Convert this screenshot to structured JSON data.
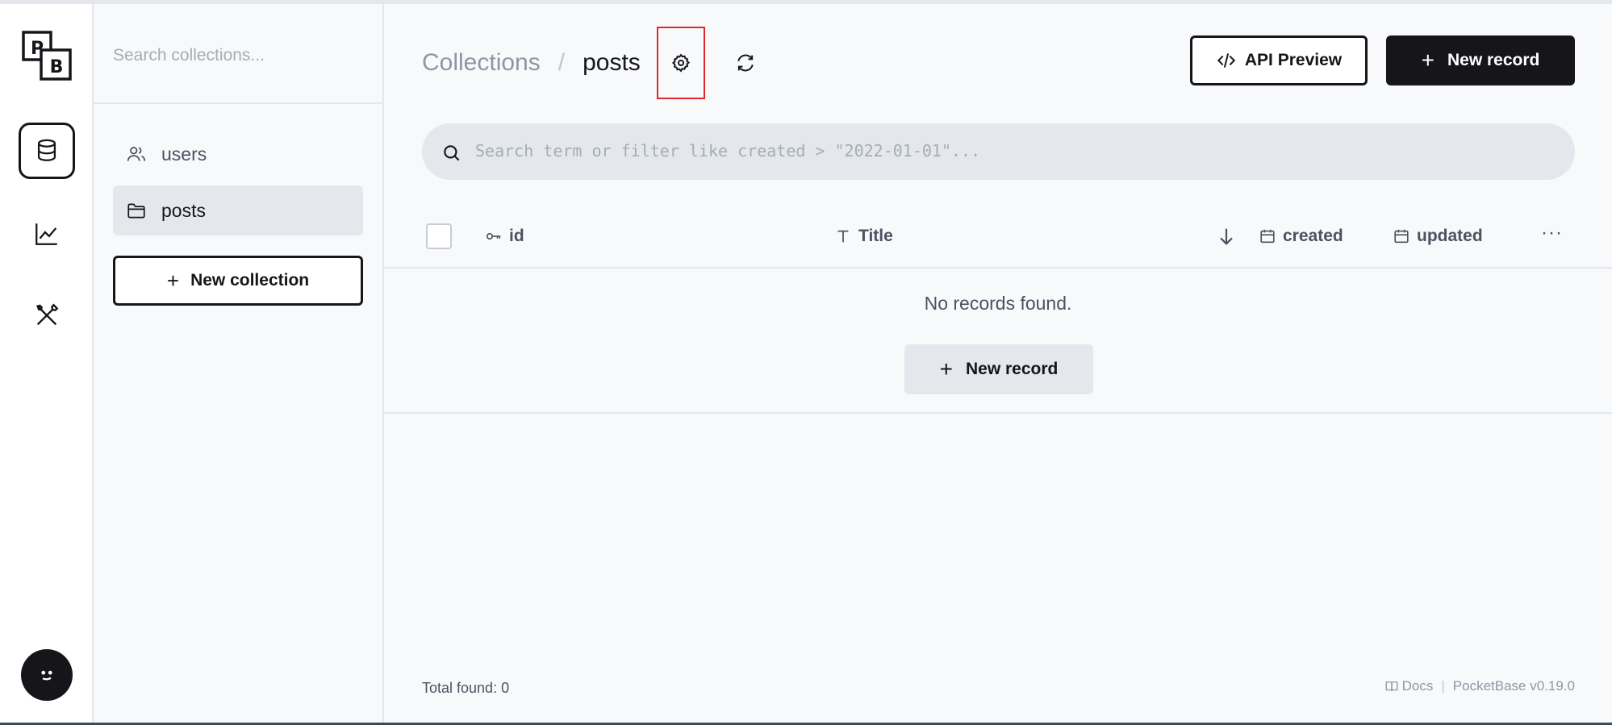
{
  "rail": {
    "logo": {
      "letter_top": "P",
      "letter_bottom": "B"
    },
    "items": [
      {
        "name": "collections",
        "icon": "database-icon",
        "active": true
      },
      {
        "name": "logs",
        "icon": "chart-line-icon",
        "active": false
      },
      {
        "name": "settings",
        "icon": "tools-icon",
        "active": false
      }
    ]
  },
  "sidebar": {
    "search_placeholder": "Search collections...",
    "items": [
      {
        "label": "users",
        "icon": "users-icon"
      },
      {
        "label": "posts",
        "icon": "folder-icon",
        "active": true
      }
    ],
    "new_collection_label": "New collection"
  },
  "header": {
    "breadcrumb_parent": "Collections",
    "breadcrumb_sep": "/",
    "breadcrumb_current": "posts",
    "api_preview_label": "API Preview",
    "new_record_label": "New record"
  },
  "search": {
    "placeholder": "Search term or filter like created > \"2022-01-01\"..."
  },
  "table": {
    "columns": [
      {
        "label": "id",
        "icon": "key-icon"
      },
      {
        "label": "Title",
        "icon": "text-icon"
      },
      {
        "label": "created",
        "icon": "calendar-icon"
      },
      {
        "label": "updated",
        "icon": "calendar-icon"
      }
    ],
    "more_label": "···",
    "empty_text": "No records found.",
    "empty_new_record_label": "New record"
  },
  "footer": {
    "total_label": "Total found:",
    "total_value": "0",
    "docs_label": "Docs",
    "separator": "|",
    "version": "PocketBase v0.19.0"
  },
  "colors": {
    "accent": "#16161a",
    "background": "#f8f9fb",
    "muted_bg": "#e4e8ed",
    "highlight": "#e0282e"
  }
}
